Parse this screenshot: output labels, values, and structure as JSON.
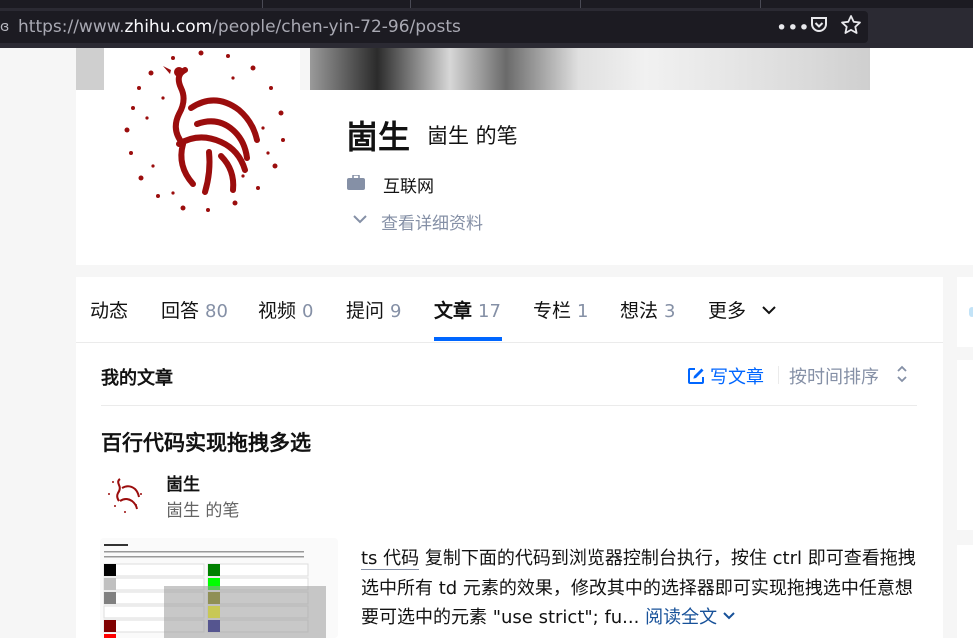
{
  "browser": {
    "url_prefix": "https://www.",
    "url_host": "zhihu.com",
    "url_path": "/people/chen-yin-72-96/posts",
    "more_label": "•••",
    "pocket_icon": "pocket-icon",
    "star_icon": "star-icon"
  },
  "profile": {
    "name": "崮生",
    "headline": "崮生 的笔",
    "industry": "互联网",
    "detail_link": "查看详细资料"
  },
  "tabs": [
    {
      "label": "动态",
      "count": ""
    },
    {
      "label": "回答",
      "count": "80"
    },
    {
      "label": "视频",
      "count": "0"
    },
    {
      "label": "提问",
      "count": "9"
    },
    {
      "label": "文章",
      "count": "17"
    },
    {
      "label": "专栏",
      "count": "1"
    },
    {
      "label": "想法",
      "count": "3"
    },
    {
      "label": "更多",
      "count": ""
    }
  ],
  "active_tab": "文章",
  "section": {
    "title": "我的文章",
    "write_label": "写文章",
    "sort_label": "按时间排序"
  },
  "article": {
    "title": "百行代码实现拖拽多选",
    "author_name": "崮生",
    "author_headline": "崮生 的笔",
    "excerpt_keyword": "ts 代码",
    "excerpt_text": " 复制下面的代码到浏览器控制台执行，按住 ctrl 即可查看拖拽选中所有 td 元素的效果，修改其中的选择器即可实现拖拽选中任意想要可选中的元素 \"use strict\"; fu...",
    "read_more": "阅读全文"
  },
  "colors": {
    "accent": "#0066ff",
    "muted": "#8590a6",
    "link": "#175199",
    "seal_red": "#9b0d0d"
  }
}
